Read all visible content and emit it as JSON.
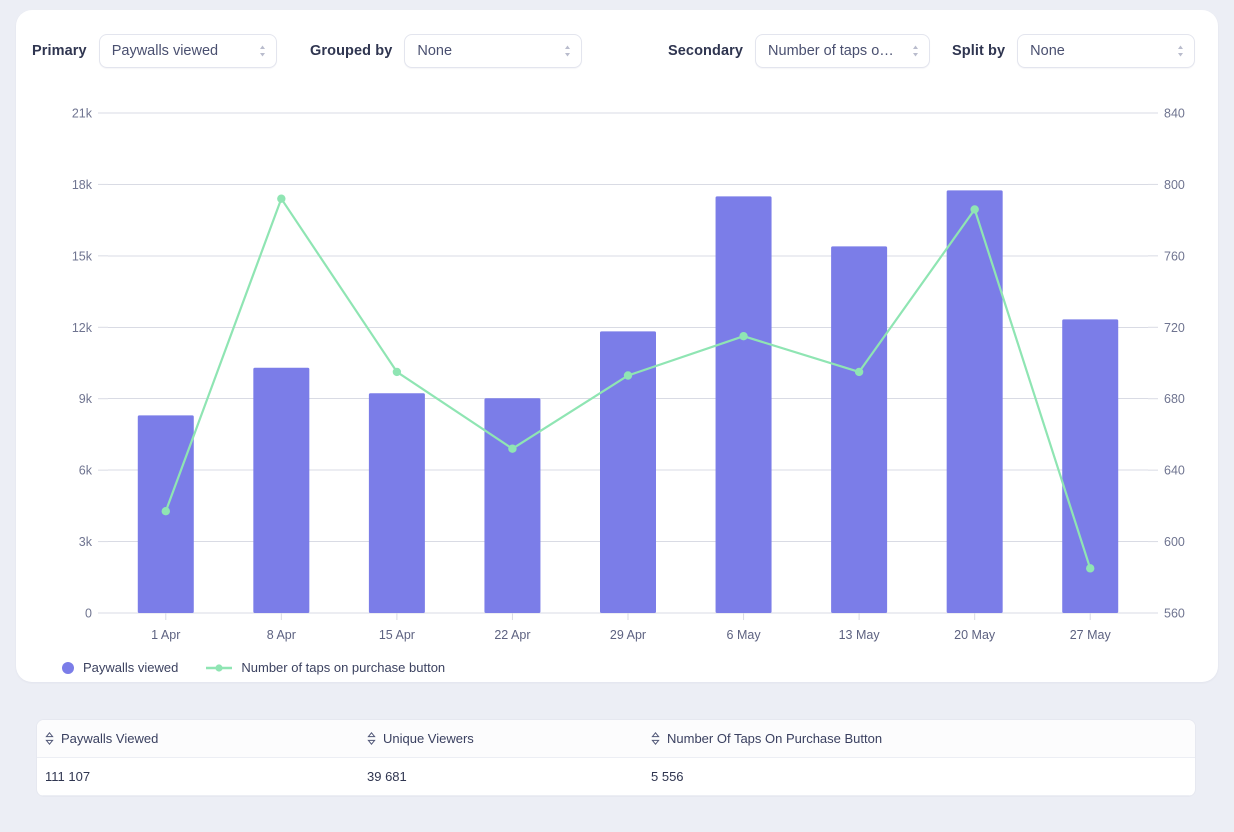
{
  "controls": [
    {
      "label": "Primary",
      "name": "primary",
      "value": "Paywalls viewed",
      "icon": "stepper-icon"
    },
    {
      "label": "Grouped by",
      "name": "grouped-by",
      "value": "None",
      "icon": "stepper-icon"
    },
    {
      "label": "Secondary",
      "name": "secondary",
      "value": "Number of taps on…",
      "icon": "stepper-icon"
    },
    {
      "label": "Split by",
      "name": "split-by",
      "value": "None",
      "icon": "stepper-icon"
    }
  ],
  "colors": {
    "bar": "#7b7de8",
    "line": "#8fe5b3",
    "grid": "#d9dbe4",
    "page_bg": "#eceef5",
    "card_bg": "#ffffff",
    "axis_text": "#6f7490"
  },
  "legend": [
    {
      "label": "Paywalls viewed",
      "marker": "dot",
      "color": "#7b7de8"
    },
    {
      "label": "Number of taps on purchase button",
      "marker": "line-dot",
      "color": "#8fe5b3"
    }
  ],
  "table": {
    "columns": [
      "Paywalls Viewed",
      "Unique Viewers",
      "Number Of Taps On Purchase Button"
    ],
    "rows": [
      [
        "111 107",
        "39 681",
        "5 556"
      ]
    ]
  },
  "chart_data": {
    "type": "bar",
    "title": "",
    "xlabel": "",
    "grid": true,
    "legend_position": "bottom-left",
    "categories": [
      "1 Apr",
      "8 Apr",
      "15 Apr",
      "22 Apr",
      "29 Apr",
      "6 May",
      "13 May",
      "20 May",
      "27 May"
    ],
    "axes": {
      "left": {
        "label": "Paywalls viewed",
        "ticks": [
          "0",
          "3k",
          "6k",
          "9k",
          "12k",
          "15k",
          "18k",
          "21k"
        ],
        "ylim": [
          0,
          21000
        ]
      },
      "right": {
        "label": "Number of taps on purchase button",
        "ticks": [
          "560",
          "600",
          "640",
          "680",
          "720",
          "760",
          "800",
          "840"
        ],
        "ylim": [
          560,
          840
        ]
      }
    },
    "series": [
      {
        "name": "Paywalls viewed",
        "type": "bar",
        "axis": "left",
        "color": "#7b7de8",
        "values": [
          8300,
          10300,
          9230,
          9020,
          11830,
          17500,
          15400,
          17750,
          12330
        ]
      },
      {
        "name": "Number of taps on purchase button",
        "type": "line",
        "axis": "right",
        "color": "#8fe5b3",
        "values": [
          617,
          792,
          695,
          652,
          693,
          715,
          695,
          786,
          585
        ]
      }
    ]
  }
}
